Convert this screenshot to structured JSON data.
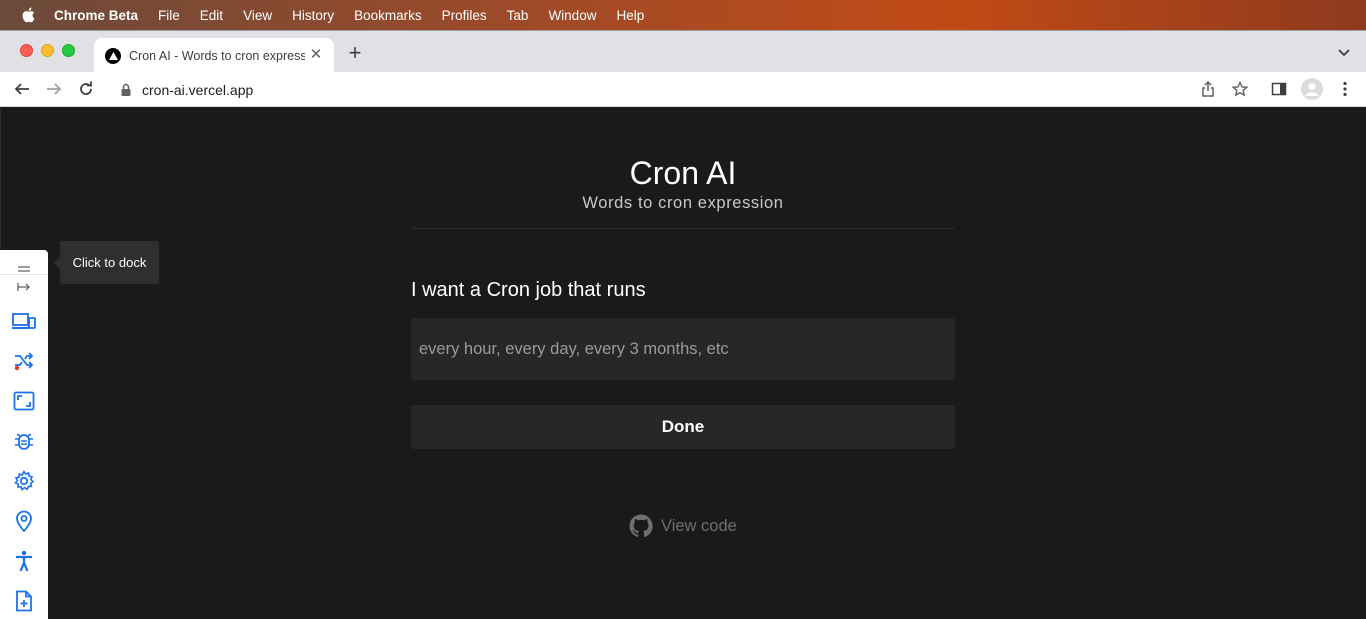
{
  "menubar": {
    "app_name": "Chrome Beta",
    "items": [
      "File",
      "Edit",
      "View",
      "History",
      "Bookmarks",
      "Profiles",
      "Tab",
      "Window",
      "Help"
    ]
  },
  "browser": {
    "tab_title": "Cron AI - Words to cron expression",
    "url": "cron-ai.vercel.app"
  },
  "page": {
    "title": "Cron AI",
    "subtitle": "Words to cron expression",
    "prompt_label": "I want a Cron job that runs",
    "input_placeholder": "every hour, every day, every 3 months, etc",
    "input_value": "",
    "done_label": "Done",
    "view_code_label": "View code"
  },
  "sidebar": {
    "tooltip": "Click to dock",
    "icons": [
      "devices-icon",
      "shuffle-icon",
      "resize-icon",
      "bug-icon",
      "settings-icon",
      "location-icon",
      "accessibility-icon",
      "file-add-icon"
    ]
  },
  "colors": {
    "page_bg": "#1a1a1a",
    "input_bg": "#272727",
    "sidebar_icon": "#1a73e8"
  }
}
